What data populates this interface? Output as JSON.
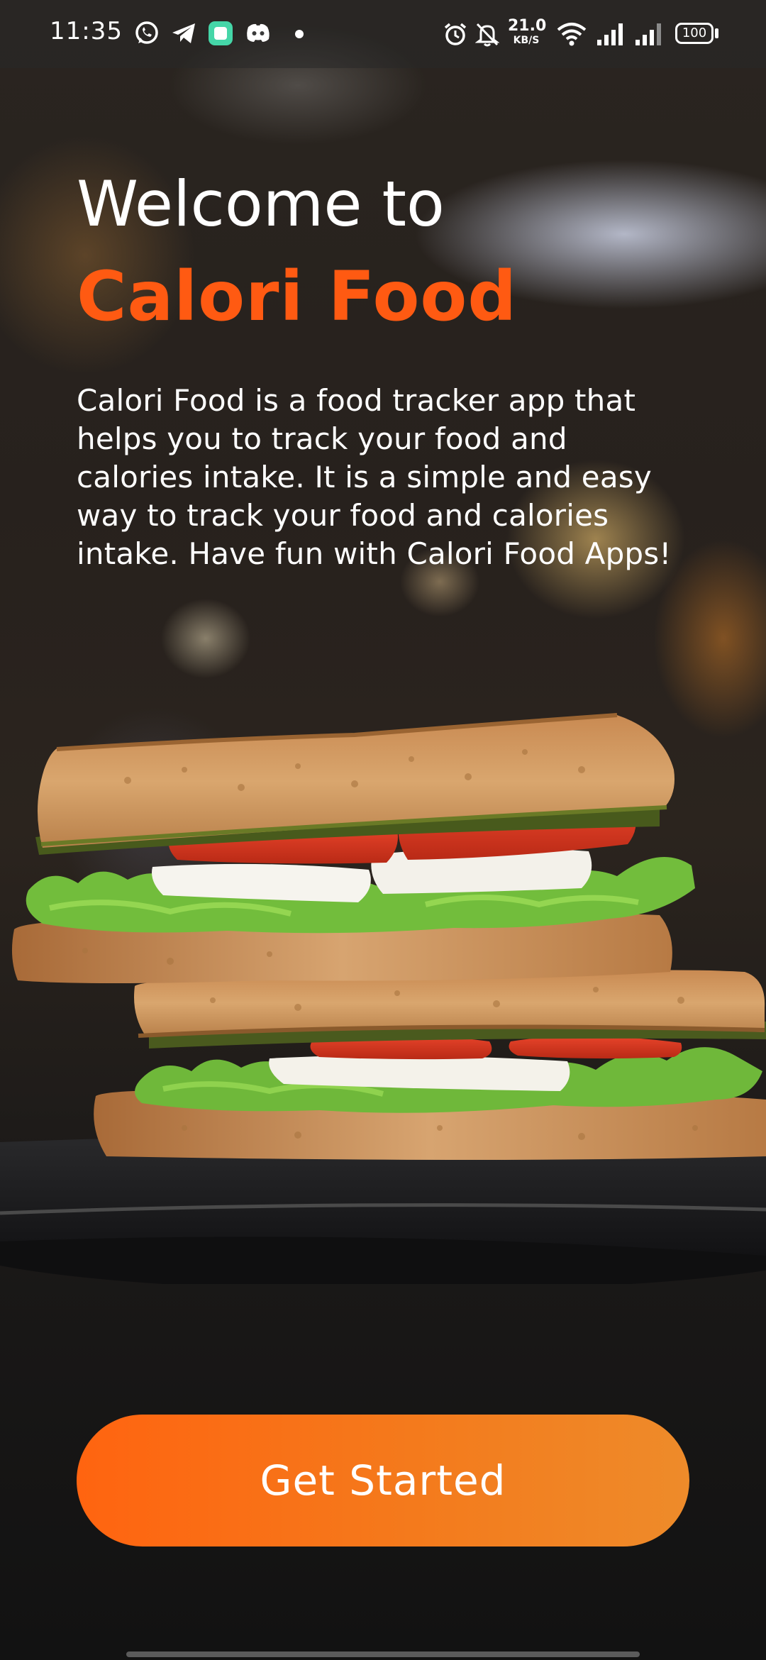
{
  "status_bar": {
    "time": "11:35",
    "net_speed_value": "21.0",
    "net_speed_unit": "KB/S",
    "battery": "100",
    "icons": [
      "whatsapp-icon",
      "telegram-icon",
      "app-icon",
      "discord-icon",
      "alarm-icon",
      "bell-muted-icon",
      "wifi-icon",
      "signal-icon",
      "signal-icon",
      "battery-icon"
    ]
  },
  "hero": {
    "welcome": "Welcome to",
    "brand": "Calori Food",
    "description": "Calori Food is a food tracker app that helps you to track your food and calories intake. It is a simple and easy way to track your food and calories intake. Have fun with Calori Food Apps!"
  },
  "cta": {
    "label": "Get Started"
  },
  "colors": {
    "brand_orange": "#ff5a12",
    "button_start": "#ff6410",
    "button_end": "#ee8b2a",
    "text": "#ffffff"
  }
}
